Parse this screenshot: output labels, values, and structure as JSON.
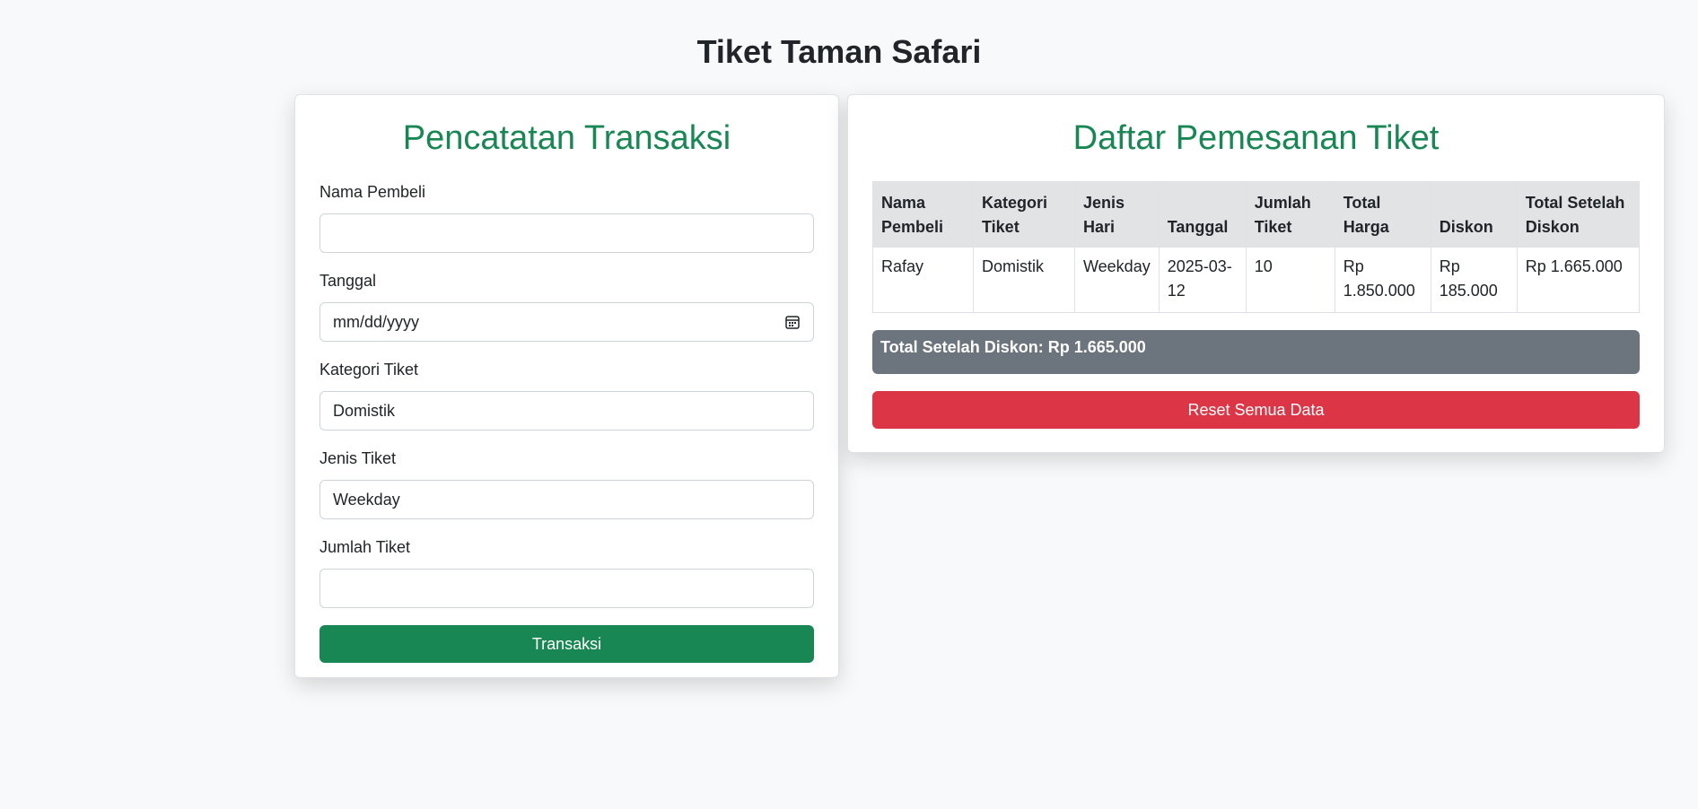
{
  "page": {
    "title": "Tiket Taman Safari"
  },
  "form": {
    "heading": "Pencatatan Transaksi",
    "fields": {
      "nama_pembeli": {
        "label": "Nama Pembeli",
        "value": ""
      },
      "tanggal": {
        "label": "Tanggal",
        "placeholder": "mm/dd/yyyy"
      },
      "kategori_tiket": {
        "label": "Kategori Tiket",
        "selected": "Domistik"
      },
      "jenis_tiket": {
        "label": "Jenis Tiket",
        "selected": "Weekday"
      },
      "jumlah_tiket": {
        "label": "Jumlah Tiket",
        "value": ""
      }
    },
    "submit_label": "Transaksi"
  },
  "list": {
    "heading": "Daftar Pemesanan Tiket",
    "columns": [
      "Nama Pembeli",
      "Kategori Tiket",
      "Jenis Hari",
      "Tanggal",
      "Jumlah Tiket",
      "Total Harga",
      "Diskon",
      "Total Setelah Diskon"
    ],
    "rows": [
      [
        "Rafay",
        "Domistik",
        "Weekday",
        "2025-03-12",
        "10",
        "Rp 1.850.000",
        "Rp 185.000",
        "Rp 1.665.000"
      ]
    ],
    "summary": "Total Setelah Diskon: Rp 1.665.000",
    "reset_label": "Reset Semua Data"
  },
  "colors": {
    "accent": "#198754",
    "danger": "#dc3545",
    "secondary": "#6c757d"
  }
}
